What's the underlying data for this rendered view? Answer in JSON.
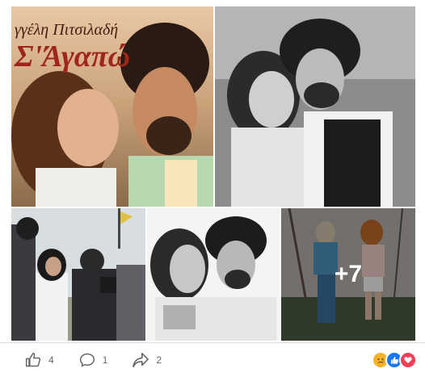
{
  "post": {
    "cover": {
      "title_line1": "γγέλη Πιτσιλαδή",
      "title_line2": "Σ'Άγαπώ"
    },
    "more_photos_label": "+7",
    "photos": [
      {
        "name": "photo-album-cover",
        "description": "album-cover"
      },
      {
        "name": "photo-couple-bw",
        "description": "couple-bw"
      },
      {
        "name": "photo-film-crew",
        "description": "film-crew"
      },
      {
        "name": "photo-couple-close",
        "description": "couple-close"
      },
      {
        "name": "photo-outdoor-tennis",
        "description": "tennis"
      }
    ]
  },
  "footer": {
    "like_count": "4",
    "comment_count": "1",
    "share_count": "2",
    "reaction_colors": {
      "sad": "#f7b125",
      "like": "#1877f2",
      "love": "#f33e58"
    },
    "icon_color": "#65676b"
  }
}
